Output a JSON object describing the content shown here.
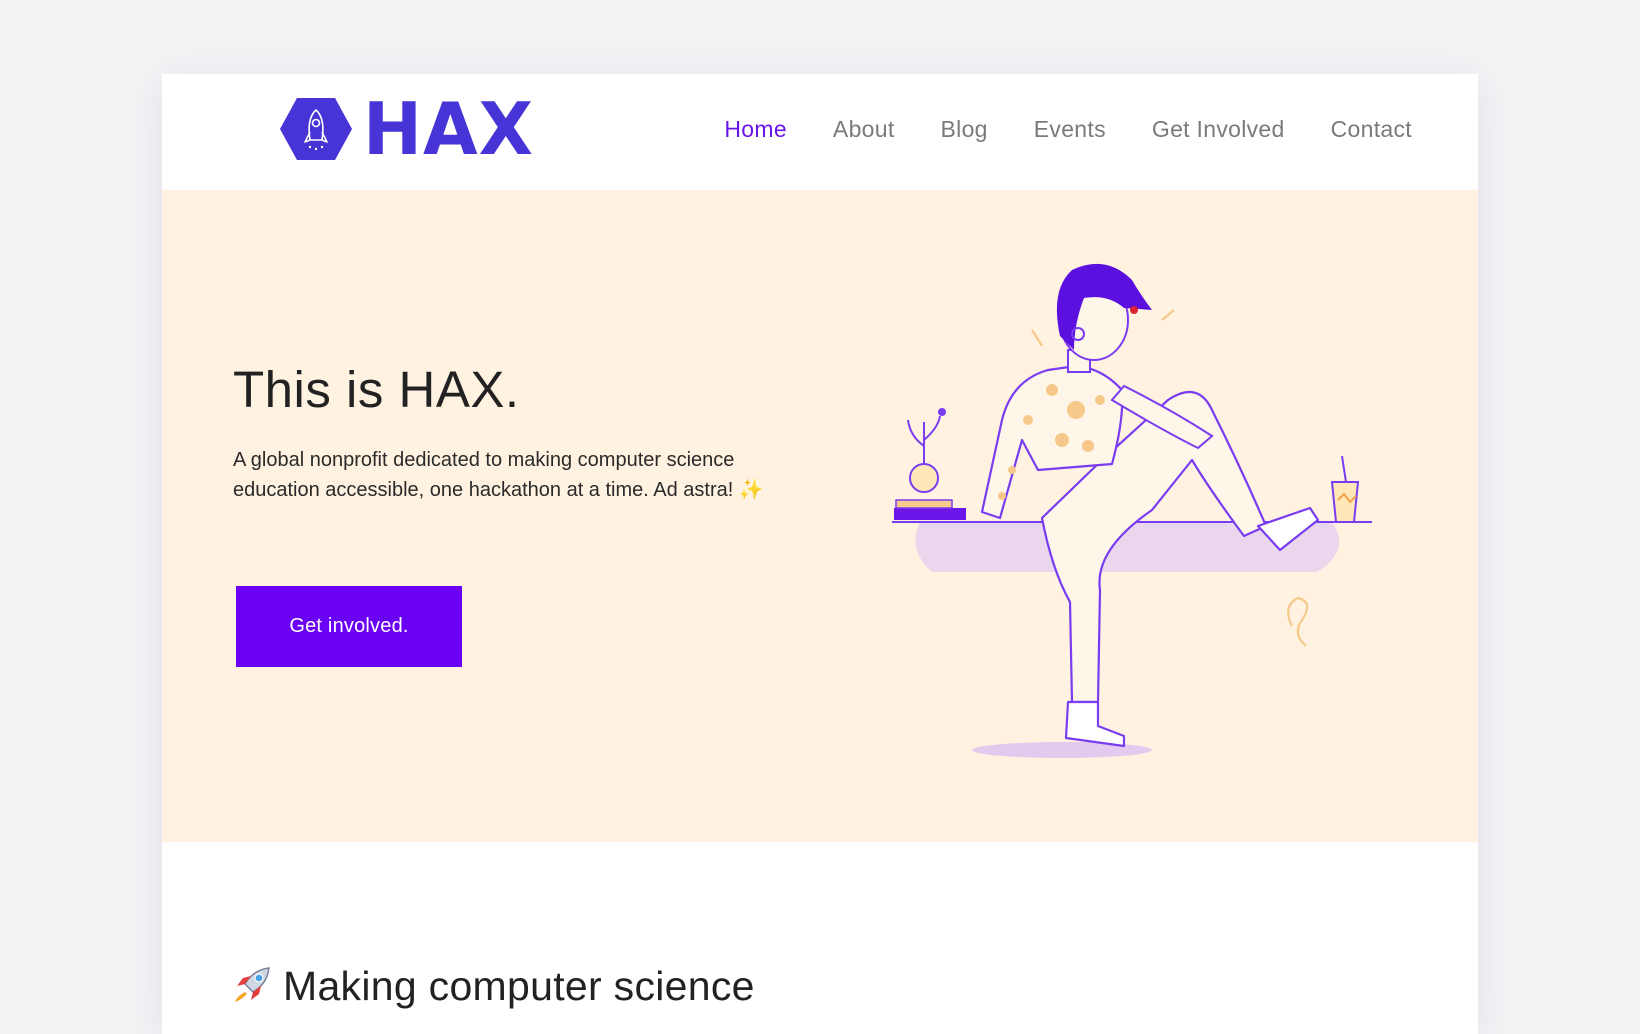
{
  "brand": {
    "name": "HAX",
    "color": "#4734d6"
  },
  "nav": {
    "items": [
      {
        "label": "Home",
        "active": true
      },
      {
        "label": "About",
        "active": false
      },
      {
        "label": "Blog",
        "active": false
      },
      {
        "label": "Events",
        "active": false
      },
      {
        "label": "Get Involved",
        "active": false
      },
      {
        "label": "Contact",
        "active": false
      }
    ],
    "active_color": "#6a16e8",
    "inactive_color": "#7a7a7a"
  },
  "hero": {
    "title": "This is HAX.",
    "description": "A global nonprofit dedicated to making computer science education accessible, one hackathon at a time. Ad astra!",
    "sparkle": "✨",
    "cta_label": "Get involved.",
    "background": "#fff2e1",
    "cta_color": "#6a00f4",
    "illustration_icon": "woman-sitting-illustration"
  },
  "section": {
    "title": "Making computer science",
    "icon": "rocket-icon"
  }
}
